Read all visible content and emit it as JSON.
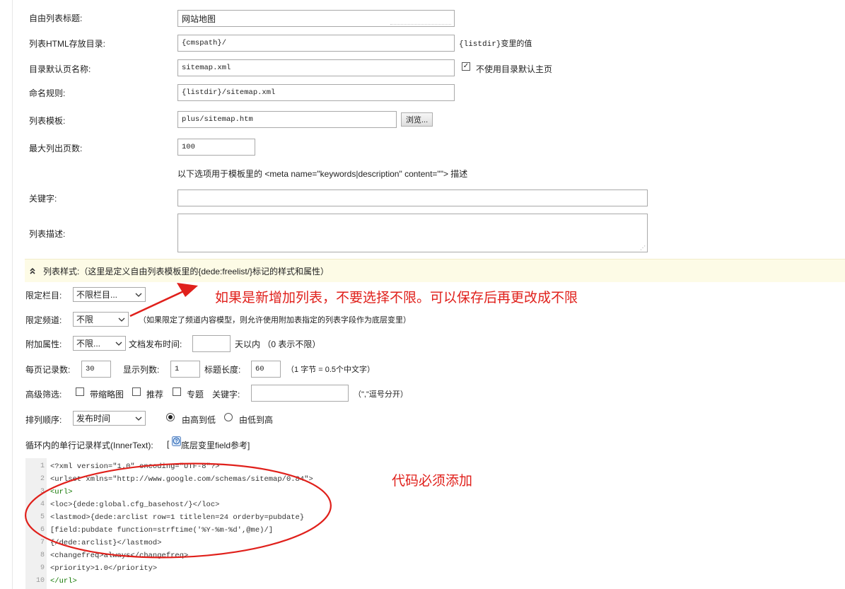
{
  "form": {
    "title_label": "自由列表标题:",
    "title_value": "网站地图",
    "html_dir_label": "列表HTML存放目录:",
    "html_dir_value": "{cmspath}/",
    "html_dir_hint": "{listdir}变里的值",
    "default_page_label": "目录默认页名称:",
    "default_page_value": "sitemap.xml",
    "no_default_checkbox_label": "不使用目录默认主页",
    "no_default_checked": true,
    "naming_rule_label": "命名规则:",
    "naming_rule_value": "{listdir}/sitemap.xml",
    "template_label": "列表模板:",
    "template_value": "plus/sitemap.htm",
    "browse_button": "浏览...",
    "max_pages_label": "最大列出页数:",
    "max_pages_value": "100",
    "meta_note": "以下选项用于模板里的 <meta name=\"keywords|description\" content=\"\"> 描述",
    "keywords_label": "关键字:",
    "keywords_value": "",
    "description_label": "列表描述:",
    "description_value": ""
  },
  "style_section": {
    "collapse_icon": "double-chevron-up-icon",
    "title": "列表样式:（这里是定义自由列表模板里的{dede:freelist/}标记的样式和属性）",
    "limit_column_label": "限定栏目:",
    "limit_column_value": "不限栏目...",
    "limit_channel_label": "限定频道:",
    "limit_channel_value": "不限",
    "limit_channel_hint": "（如果限定了频道内容模型，则允许使用附加表指定的列表字段作为底层变里）",
    "extra_attr_label": "附加属性:",
    "extra_attr_value": "不限...",
    "publish_time_label": "文档发布时间:",
    "publish_time_value": "",
    "publish_time_suffix": "天以内 （0 表示不限）",
    "per_page_label": "每页记录数:",
    "per_page_value": "30",
    "columns_label": "显示列数:",
    "columns_value": "1",
    "title_length_label": "标题长度:",
    "title_length_value": "60",
    "title_length_hint": "（1 字节 = 0.5个中文字）",
    "advanced_filter_label": "高级筛选:",
    "filter_thumb_label": "带缩略图",
    "filter_recommend_label": "推荐",
    "filter_topic_label": "专题",
    "filter_keyword_label": "关键字:",
    "filter_keyword_value": "",
    "filter_keyword_hint": "（\",\"逗号分开）",
    "sort_label": "排列顺序:",
    "sort_value": "发布时间",
    "order_desc_label": "由高到低",
    "order_asc_label": "由低到高",
    "order_selected": "desc",
    "innertext_label": "循环内的单行记录样式(InnerText):",
    "innertext_link": "底层变里field参考",
    "help_icon": "help-icon"
  },
  "code_lines": [
    "<?xml version=\"1.0\" encoding=\"UTF-8\"?>",
    "<urlset xmlns=\"http://www.google.com/schemas/sitemap/0.84\">",
    "<url>",
    "<loc>{dede:global.cfg_basehost/}</loc>",
    "<lastmod>{dede:arclist row=1 titlelen=24 orderby=pubdate}",
    "[field:pubdate function=strftime('%Y-%m-%d',@me)/]",
    "{/dede:arclist}</lastmod>",
    "<changefreq>always</changefreq>",
    "<priority>1.0</priority>",
    "</url>"
  ],
  "code_line_numbers": [
    "1",
    "2",
    "3",
    "4",
    "5",
    "6",
    "7",
    "8",
    "9",
    "10"
  ],
  "annotations": {
    "note_1": "如果是新增加列表，不要选择不限。可以保存后再更改成不限",
    "note_2": "代码必须添加",
    "color": "#e0201b"
  }
}
